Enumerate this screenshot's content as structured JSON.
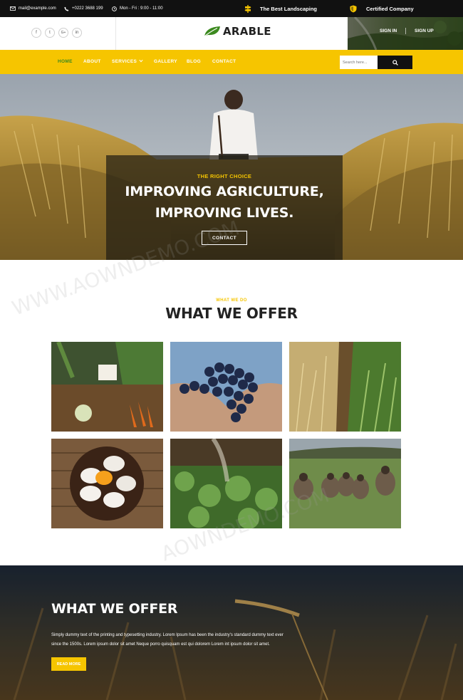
{
  "topbar": {
    "email": "mail@example.com",
    "phone": "+0222 3688 199",
    "hours": "Mon - Fri : 9:00 - 11:00",
    "tagline": "The Best Landscaping",
    "certified": "Certified Company"
  },
  "header": {
    "social": [
      "f",
      "t",
      "G+",
      "in"
    ],
    "logo": "ARABLE",
    "sign_in": "SIGN IN",
    "sign_up": "SIGN UP"
  },
  "nav": {
    "items": [
      "HOME",
      "ABOUT",
      "SERVICES",
      "GALLERY",
      "BLOG",
      "CONTACT"
    ],
    "search_placeholder": "Search here..."
  },
  "hero": {
    "subtitle": "THE RIGHT CHOICE",
    "title_line1": "IMPROVING AGRICULTURE,",
    "title_line2": "IMPROVING LIVES.",
    "button": "CONTACT"
  },
  "offer": {
    "subtitle": "WHAT WE DO",
    "title": "WHAT WE OFFER"
  },
  "banner": {
    "title": "WHAT WE OFFER",
    "text_line1": "Simply dummy text of the printing and typesetting industry. Lorem Ipsum has been the industry's standard dummy text ever",
    "text_line2": "since the 1500s. Lorem ipsum dolor sit amet Neque porro quisquam est qui dolorem Lorem int ipsum dolor sit amet.",
    "button": "READ MORE"
  },
  "colors": {
    "accent": "#f6c500",
    "active_nav": "#3c8a1f",
    "dark": "#111111"
  },
  "watermark": [
    "WWW.AOWNDEMO.COM",
    "AOWNDEMO.COM"
  ]
}
